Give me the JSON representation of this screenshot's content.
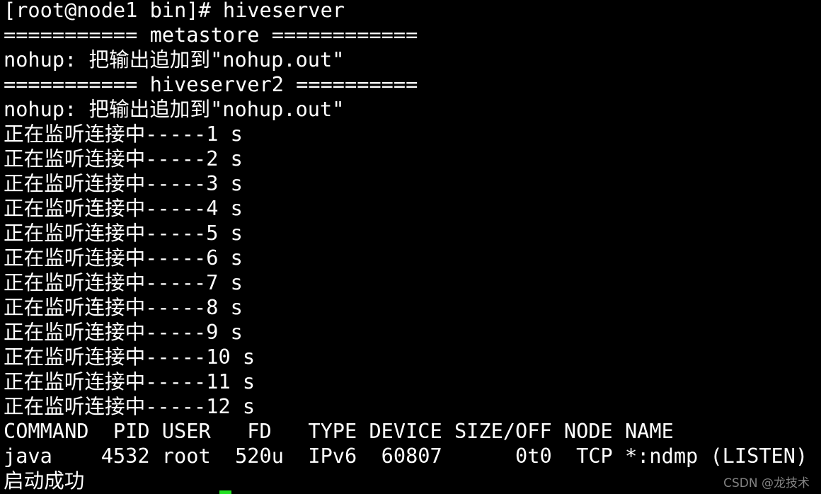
{
  "terminal": {
    "lines": [
      "[root@node1 bin]# hiveserver",
      "=========== metastore ============",
      "nohup: 把输出追加到\"nohup.out\"",
      "=========== hiveserver2 ==========",
      "nohup: 把输出追加到\"nohup.out\"",
      "正在监听连接中-----1 s",
      "正在监听连接中-----2 s",
      "正在监听连接中-----3 s",
      "正在监听连接中-----4 s",
      "正在监听连接中-----5 s",
      "正在监听连接中-----6 s",
      "正在监听连接中-----7 s",
      "正在监听连接中-----8 s",
      "正在监听连接中-----9 s",
      "正在监听连接中-----10 s",
      "正在监听连接中-----11 s",
      "正在监听连接中-----12 s",
      "COMMAND  PID USER   FD   TYPE DEVICE SIZE/OFF NODE NAME",
      "java    4532 root  520u  IPv6  60807      0t0  TCP *:ndmp (LISTEN)",
      "启动成功"
    ],
    "cursor_color": "#22e022",
    "text_color": "#ffffff",
    "background": "#000000"
  },
  "watermark": "CSDN @龙技术"
}
